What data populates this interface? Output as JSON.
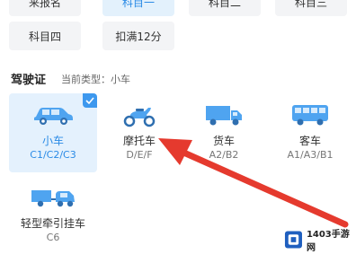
{
  "subjects": {
    "row1": [
      "来报名",
      "科目一",
      "科目二",
      "科目三"
    ],
    "row2": [
      "科目四",
      "扣满12分"
    ]
  },
  "license": {
    "title": "驾驶证",
    "current_type": "当前类型：小车"
  },
  "vehicles": [
    {
      "name": "小车",
      "code": "C1/C2/C3",
      "icon": "car-icon",
      "selected": true
    },
    {
      "name": "摩托车",
      "code": "D/E/F",
      "icon": "motorcycle-icon",
      "selected": false
    },
    {
      "name": "货车",
      "code": "A2/B2",
      "icon": "truck-icon",
      "selected": false
    },
    {
      "name": "客车",
      "code": "A1/A3/B1",
      "icon": "bus-icon",
      "selected": false
    },
    {
      "name": "轻型牵引挂车",
      "code": "C6",
      "icon": "trailer-icon",
      "selected": false
    }
  ],
  "colors": {
    "accent": "#2b8be6",
    "icon_blue": "#4fa4f0",
    "arrow_red": "#e53a2e"
  },
  "watermark": {
    "text": "1403手游网"
  }
}
